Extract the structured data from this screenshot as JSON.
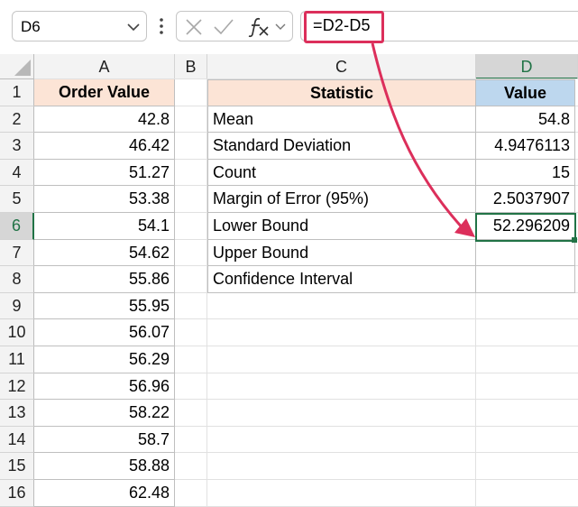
{
  "formula_bar": {
    "name_box": "D6",
    "formula": "=D2-D5"
  },
  "columns": [
    "A",
    "B",
    "C",
    "D"
  ],
  "rows": [
    "1",
    "2",
    "3",
    "4",
    "5",
    "6",
    "7",
    "8",
    "9",
    "10",
    "11",
    "12",
    "13",
    "14",
    "15",
    "16"
  ],
  "order_values": {
    "header": "Order Value",
    "values": [
      "42.8",
      "46.42",
      "51.27",
      "53.38",
      "54.1",
      "54.62",
      "55.86",
      "55.95",
      "56.07",
      "56.29",
      "56.96",
      "58.22",
      "58.7",
      "58.88",
      "62.48"
    ]
  },
  "stats_table": {
    "header_statistic": "Statistic",
    "header_value": "Value",
    "rows": [
      {
        "label": "Mean",
        "value": "54.8"
      },
      {
        "label": "Standard Deviation",
        "value": "4.9476113"
      },
      {
        "label": "Count",
        "value": "15"
      },
      {
        "label": "Margin of Error (95%)",
        "value": "2.5037907"
      },
      {
        "label": "Lower Bound",
        "value": "52.296209"
      },
      {
        "label": "Upper Bound",
        "value": ""
      },
      {
        "label": "Confidence Interval",
        "value": ""
      }
    ]
  },
  "colors": {
    "header_peach": "#fce4d6",
    "header_blue": "#bdd7ee",
    "selection_green": "#217346",
    "highlight_red": "#dc2f5b"
  },
  "icons": [
    "chevron-down-icon",
    "more-options-icon",
    "cancel-icon",
    "enter-icon",
    "insert-function-icon",
    "arrow-annotation"
  ]
}
